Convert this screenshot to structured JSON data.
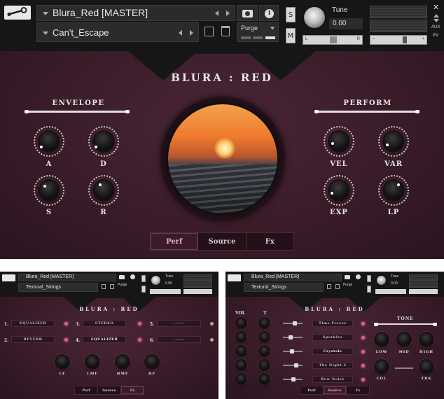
{
  "main": {
    "instrument_name": "Blura_Red [MASTER]",
    "preset_name": "Can't_Escape",
    "purge_label": "Purge",
    "solo_label": "S",
    "mute_label": "M",
    "tune_label": "Tune",
    "tune_value": "0.00",
    "pan_left": "L",
    "pan_right": "R",
    "vol_minus": "–",
    "vol_plus": "+",
    "close_glyph": "✕",
    "aux_label": "AUX",
    "pv_label": "PV",
    "title": "BLURA : RED",
    "envelope_label": "ENVELOPE",
    "perform_label": "PERFORM",
    "knobs_left": [
      "A",
      "D",
      "S",
      "R"
    ],
    "knobs_right": [
      "VEL",
      "VAR",
      "EXP",
      "LP"
    ],
    "tabs": [
      "Perf",
      "Source",
      "Fx"
    ],
    "active_tab": "Perf"
  },
  "fx_view": {
    "instrument_name": "Blura_Red [MASTER]",
    "preset_name": "Textural_Strings",
    "purge_label": "Purge",
    "tune_label": "Tune",
    "tune_value": "0.00",
    "title": "BLURA : RED",
    "slots": [
      {
        "num": "1.",
        "name": "EQUALIZER"
      },
      {
        "num": "3.",
        "name": "STEREO"
      },
      {
        "num": "5.",
        "name": "------"
      },
      {
        "num": "2.",
        "name": "REVERB"
      },
      {
        "num": "4.",
        "name": "EQUALIZER"
      },
      {
        "num": "6.",
        "name": "------"
      }
    ],
    "knobs": [
      "LF",
      "LMF",
      "HMF",
      "HF"
    ],
    "tabs": [
      "Perf",
      "Source",
      "Fx"
    ],
    "active_tab": "Fx"
  },
  "source_view": {
    "instrument_name": "Blura_Red [MASTER]",
    "preset_name": "Textural_Strings",
    "purge_label": "Purge",
    "tune_label": "Tune",
    "tune_value": "0.00",
    "title": "BLURA : RED",
    "vol_label": "VOL",
    "pitch_label": "T",
    "layers": [
      "Time Freeze",
      "Sparkles",
      "Crystals",
      "The Night 2",
      "Bow Noise"
    ],
    "tone_label": "TONE",
    "tone_knobs": [
      "LOW",
      "MID",
      "HIGH"
    ],
    "tone_knobs2": [
      "COL",
      "TRK"
    ],
    "tabs": [
      "Perf",
      "Source",
      "Fx"
    ],
    "active_tab": "Source"
  },
  "colors": {
    "accent_pink": "#e55a96",
    "panel": "#3a1c29",
    "header": "#161616"
  },
  "icons": [
    "wrench-icon",
    "camera-icon",
    "info-icon",
    "save-icon",
    "trash-icon",
    "tune-knob-icon"
  ]
}
